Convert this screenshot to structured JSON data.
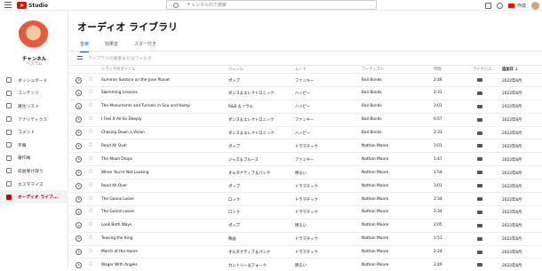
{
  "header": {
    "logo_text": "Studio",
    "search_placeholder": "チャンネル内で検索",
    "create_label": "作成"
  },
  "channel": {
    "name": "チャンネル",
    "subtitle": "イスラム"
  },
  "sidebar": {
    "items": [
      {
        "label": "ダッシュボード",
        "icon": "dashboard-icon"
      },
      {
        "label": "コンテンツ",
        "icon": "content-icon"
      },
      {
        "label": "再生リスト",
        "icon": "playlist-icon"
      },
      {
        "label": "アナリティクス",
        "icon": "analytics-icon"
      },
      {
        "label": "コメント",
        "icon": "comment-icon"
      },
      {
        "label": "字幕",
        "icon": "subtitles-icon"
      },
      {
        "label": "著作権",
        "icon": "copyright-icon"
      },
      {
        "label": "収益受け取り",
        "icon": "monetization-icon"
      },
      {
        "label": "カスタマイズ",
        "icon": "customize-icon"
      },
      {
        "label": "オーディオ ライブ...",
        "icon": "audio-library-icon",
        "active": true
      }
    ]
  },
  "main": {
    "title": "オーディオ ライブラリ",
    "tabs": [
      "音楽",
      "効果音",
      "スター付き"
    ],
    "filter_placeholder": "ライブラリの検索またはフィルタ",
    "columns": {
      "track": "トラックのタイトル",
      "genre": "ジャンル",
      "mood": "ムード",
      "artist": "アーティスト",
      "duration": "時間",
      "license": "ライセンス...",
      "added": "追加日 ↓"
    },
    "rows": [
      {
        "title": "Summer Solstice on the June Planet",
        "genre": "ポップ",
        "mood": "ファンキー",
        "artist": "Bail Bonds",
        "duration": "2:46",
        "added": "2022年8月"
      },
      {
        "title": "Swimming Lessons",
        "genre": "ダンス＆エレクトロニック",
        "mood": "ハッピー",
        "artist": "Bail Bonds",
        "duration": "2:31",
        "added": "2022年8月"
      },
      {
        "title": "The Monuments and Tunnels in Sou and Hamp",
        "genre": "R&B ＆ソウル",
        "mood": "ハッピー",
        "artist": "Bail Bonds",
        "duration": "3:01",
        "added": "2022年8月"
      },
      {
        "title": "I Feel It All So Deeply",
        "genre": "ダンス＆エレクトロニック",
        "mood": "ファンキー",
        "artist": "Bail Bonds",
        "duration": "6:57",
        "added": "2022年8月"
      },
      {
        "title": "Chasing Down a Vision",
        "genre": "ダンス＆エレクトロニック",
        "mood": "ハッピー",
        "artist": "Bail Bonds",
        "duration": "2:33",
        "added": "2022年8月"
      },
      {
        "title": "Read All Over",
        "genre": "ポップ",
        "mood": "ドラマチック",
        "artist": "Nathan Moore",
        "duration": "3:01",
        "added": "2022年8月"
      },
      {
        "title": "The Moon Drops",
        "genre": "ジャズ＆ブルース",
        "mood": "ファンキー",
        "artist": "Nathan Moore",
        "duration": "1:47",
        "added": "2022年8月"
      },
      {
        "title": "When You're Not Looking",
        "genre": "オルタナティブ＆パンク",
        "mood": "明るい",
        "artist": "Nathan Moore",
        "duration": "1:54",
        "added": "2022年8月"
      },
      {
        "title": "Read All Over",
        "genre": "ポップ",
        "mood": "ドラマチック",
        "artist": "Nathan Moore",
        "duration": "3:01",
        "added": "2022年8月"
      },
      {
        "title": "The Goonz Loose",
        "genre": "ロック",
        "mood": "ドラマチック",
        "artist": "Nathan Moore",
        "duration": "2:34",
        "added": "2022年8月"
      },
      {
        "title": "The Goonz Loose",
        "genre": "ロック",
        "mood": "ドラマチック",
        "artist": "Nathan Moore",
        "duration": "2:34",
        "added": "2022年8月"
      },
      {
        "title": "Look Both Ways",
        "genre": "ポップ",
        "mood": "明るい",
        "artist": "Nathan Moore",
        "duration": "2:05",
        "added": "2022年8月"
      },
      {
        "title": "Teasing the King",
        "genre": "映画",
        "mood": "ドラマチック",
        "artist": "Nathan Moore",
        "duration": "1:51",
        "added": "2022年8月"
      },
      {
        "title": "March of the Hares",
        "genre": "オルタナティブ＆パンク",
        "mood": "ドラマチック",
        "artist": "Nathan Moore",
        "duration": "2:24",
        "added": "2022年8月"
      },
      {
        "title": "Wager With Angels",
        "genre": "カントリー＆フォーク",
        "mood": "明るい",
        "artist": "Nathan Moore",
        "duration": "2:49",
        "added": "2022年8月"
      }
    ]
  }
}
